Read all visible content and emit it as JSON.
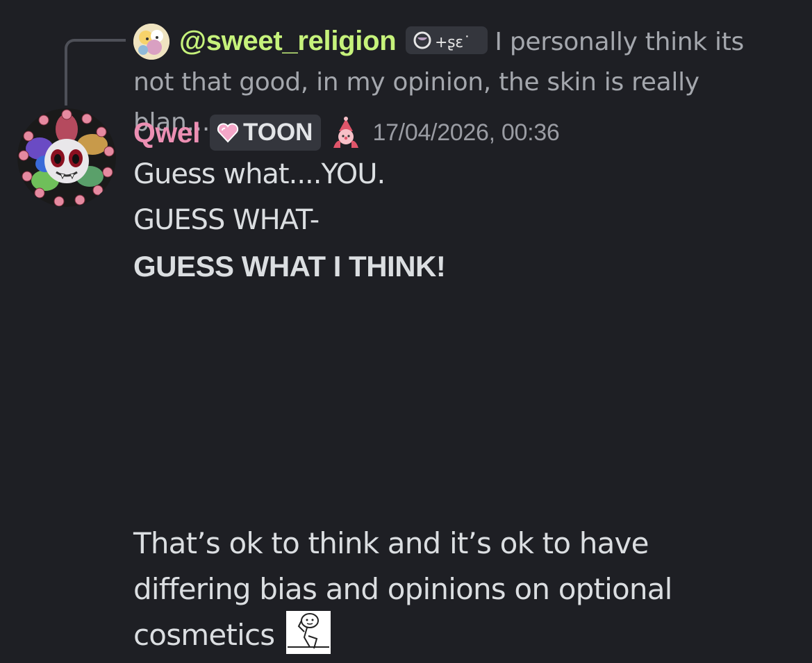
{
  "reply": {
    "author": "@sweet_religion",
    "text": "I personally think its not that good, in my opinion, the skin is really blan...",
    "avatar_icon": "reply-avatar-icon",
    "badge_icon": "moon-glyph-badge-icon"
  },
  "message": {
    "author": "Qwel",
    "author_color": "#ec8fb3",
    "tag_label": "TOON",
    "tag_icon": "pink-heart-icon",
    "role_icon": "clown-role-icon",
    "timestamp": "17/04/2026, 00:36",
    "lines": [
      "Guess what....YOU.",
      "GUESS WHAT-",
      "GUESS WHAT I THINK!"
    ]
  },
  "followup": {
    "text": "That’s ok to think and it’s ok to have differing bias and opinions on optional cosmetics",
    "emoji_icon": "thinking-meme-emoji-icon"
  },
  "colors": {
    "background": "#1e1f24",
    "reply_author": "#c6f27b",
    "muted_text": "#a4a7ad",
    "body_text": "#dbdee1"
  }
}
